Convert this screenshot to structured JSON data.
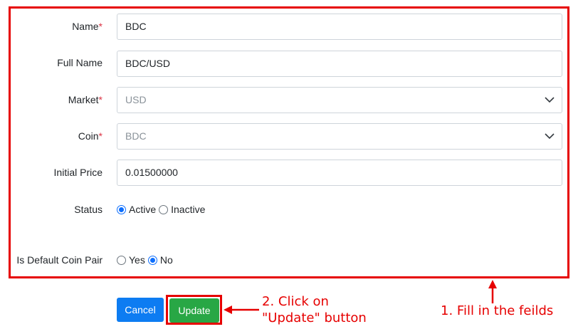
{
  "form": {
    "name_label": "Name",
    "name_value": "BDC",
    "full_name_label": "Full Name",
    "full_name_value": "BDC/USD",
    "market_label": "Market",
    "market_value": "USD",
    "coin_label": "Coin",
    "coin_value": "BDC",
    "initial_price_label": "Initial Price",
    "initial_price_value": "0.01500000",
    "status_label": "Status",
    "status_options": [
      "Active",
      "Inactive"
    ],
    "status_selected": "Active",
    "default_pair_label": "Is Default Coin Pair",
    "default_pair_options": [
      "Yes",
      "No"
    ],
    "default_pair_selected": "No",
    "required_mark": "*"
  },
  "buttons": {
    "cancel_label": "Cancel",
    "update_label": "Update"
  },
  "annotations": {
    "step1": "1. Fill in the feilds",
    "step2_line1": "2. Click on",
    "step2_line2": "\"Update\" button"
  },
  "colors": {
    "annotation_red": "#e60000",
    "primary_blue": "#0d7cf2",
    "success_green": "#28a745",
    "radio_blue": "#0d6efd",
    "required_red": "#dc3545"
  }
}
